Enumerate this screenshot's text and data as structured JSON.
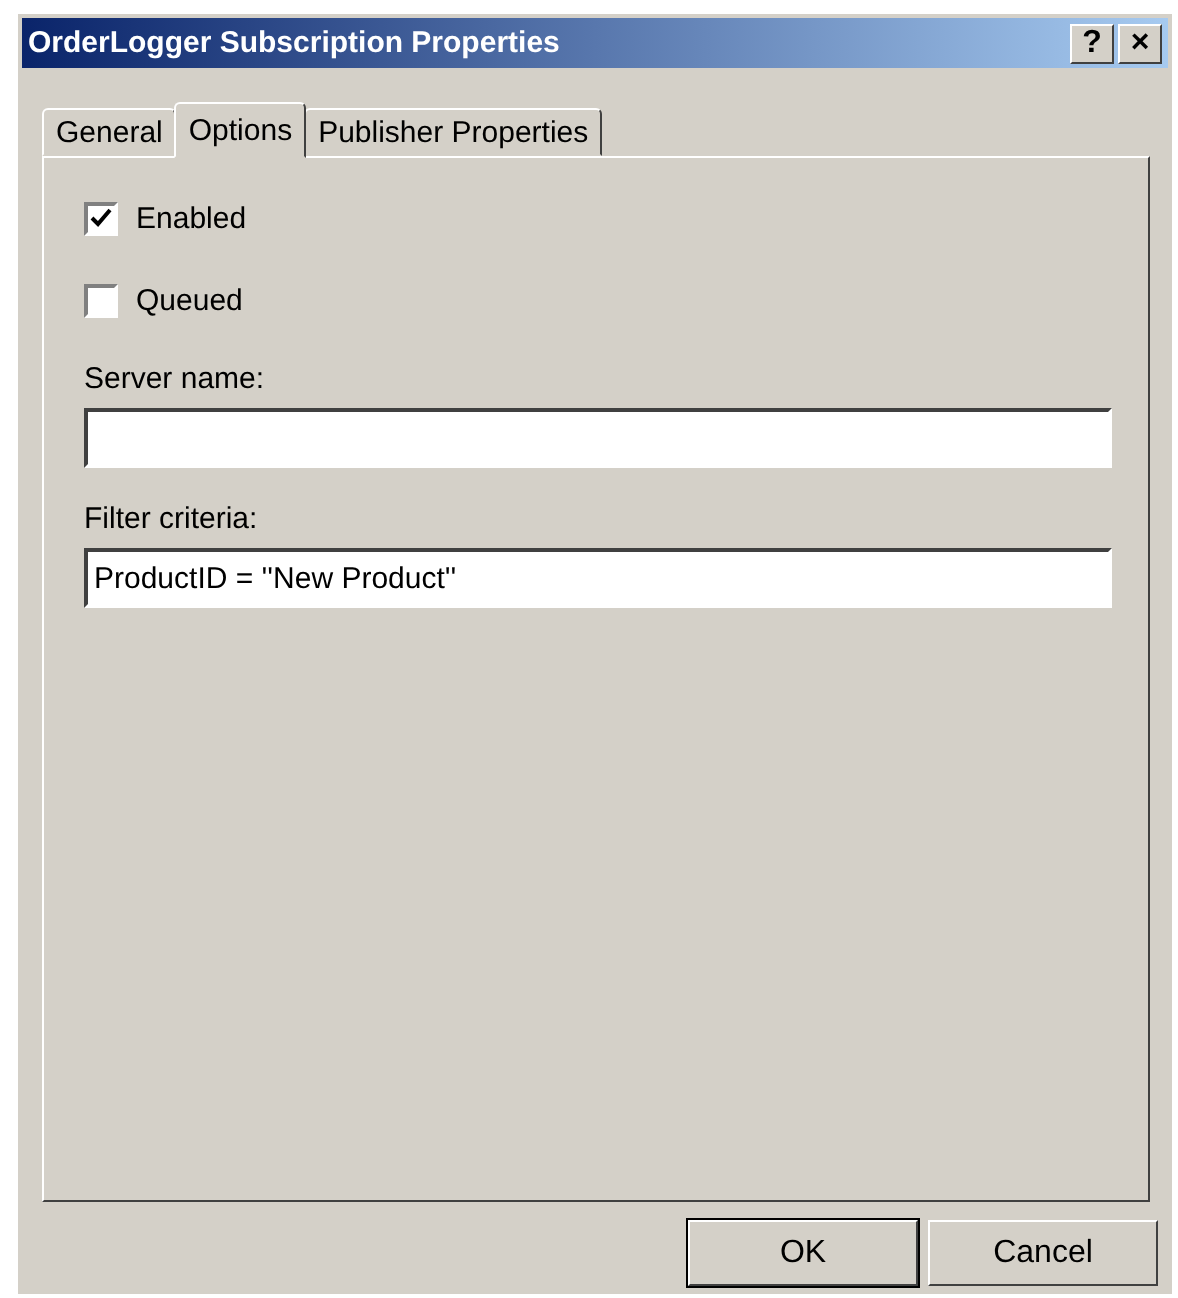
{
  "window": {
    "title": "OrderLogger Subscription Properties",
    "title_buttons": [
      "?",
      "×"
    ]
  },
  "tabs": [
    {
      "label": "General",
      "selected": false
    },
    {
      "label": "Options",
      "selected": true
    },
    {
      "label": "Publisher Properties",
      "selected": false
    }
  ],
  "checkboxes": [
    {
      "label": "Enabled",
      "checked": true
    },
    {
      "label": "Queued",
      "checked": false
    }
  ],
  "fields": [
    {
      "label": "Server name:"
    },
    {
      "label": "Filter criteria:",
      "value": "ProductID = ''New Product''"
    }
  ],
  "buttons": [
    {
      "label": "OK",
      "default": true
    },
    {
      "label": "Cancel",
      "default": false
    }
  ]
}
